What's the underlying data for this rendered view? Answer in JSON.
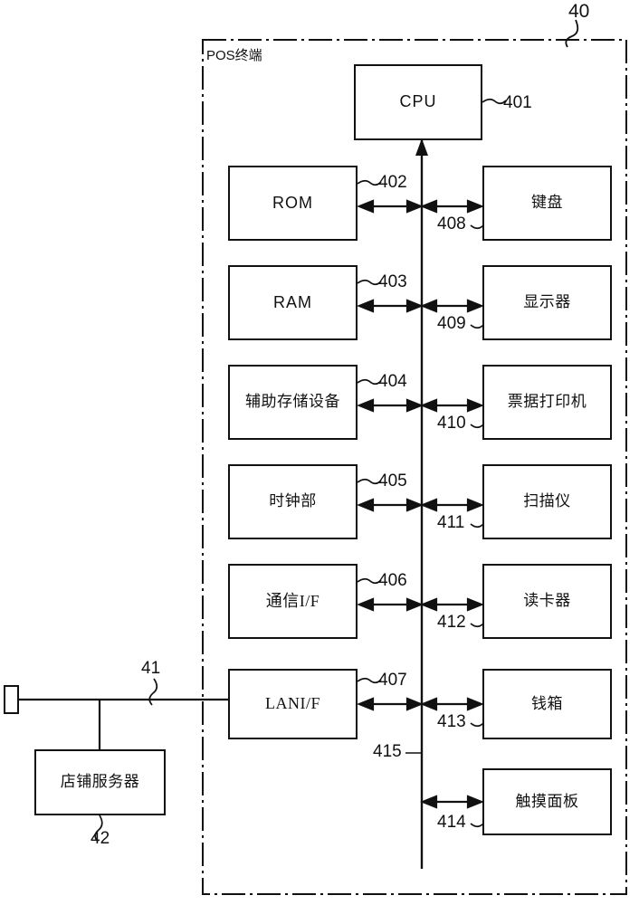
{
  "figure": {
    "enclosure_label": "POS终端",
    "enclosure_ref": "40",
    "bus_ref": "415",
    "lan_ref": "41"
  },
  "cpu": {
    "label": "CPU",
    "ref": "401"
  },
  "left_column": [
    {
      "label": "ROM",
      "ref": "402",
      "script": "latin"
    },
    {
      "label": "RAM",
      "ref": "403",
      "script": "latin"
    },
    {
      "label": "辅助存储设备",
      "ref": "404",
      "script": "cjk"
    },
    {
      "label": "时钟部",
      "ref": "405",
      "script": "cjk"
    },
    {
      "label": "通信I/F",
      "ref": "406",
      "script": "serifish"
    },
    {
      "label": "LANI/F",
      "ref": "407",
      "script": "serifish"
    }
  ],
  "right_column": [
    {
      "label": "键盘",
      "ref": "408"
    },
    {
      "label": "显示器",
      "ref": "409"
    },
    {
      "label": "票据打印机",
      "ref": "410"
    },
    {
      "label": "扫描仪",
      "ref": "411"
    },
    {
      "label": "读卡器",
      "ref": "412"
    },
    {
      "label": "钱箱",
      "ref": "413"
    },
    {
      "label": "触摸面板",
      "ref": "414"
    }
  ],
  "external": {
    "server_label": "店铺服务器",
    "server_ref": "42"
  },
  "colors": {
    "stroke": "#111111",
    "background": "#ffffff"
  }
}
